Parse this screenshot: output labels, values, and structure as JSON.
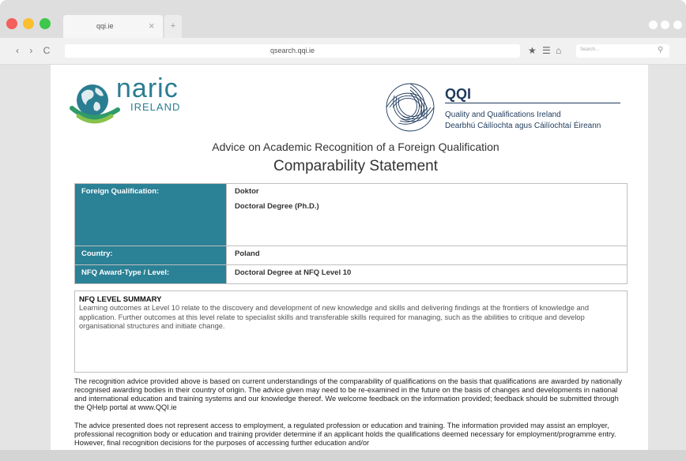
{
  "browser": {
    "tab_title": "qqi.ie",
    "tab_close": "×",
    "new_tab": "+",
    "url": "qsearch.qqi.ie",
    "nav": "‹ › C",
    "search_placeholder": "Search...",
    "icons": [
      "star-icon",
      "menu-icon",
      "home-icon",
      "search-icon"
    ]
  },
  "header": {
    "naric_logo_text": "naric",
    "naric_logo_sub": "IRELAND",
    "qqi_abbr": "QQI",
    "qqi_name_en": "Quality and Qualifications Ireland",
    "qqi_name_ga": "Dearbhú Cáilíochta agus Cáilíochtaí Éireann",
    "advice_title": "Advice on Academic Recognition of a Foreign Qualification",
    "statement_title": "Comparability Statement"
  },
  "qualification": {
    "foreign_label": "Foreign Qualification:",
    "foreign_value_1": "Doktor",
    "foreign_value_2": "Doctoral Degree (Ph.D.)",
    "country_label": "Country:",
    "country_value": "Poland",
    "nfq_label": "NFQ Award-Type /  Level:",
    "nfq_value": "Doctoral Degree at NFQ Level 10"
  },
  "summary": {
    "title": "NFQ LEVEL SUMMARY",
    "text": "Learning outcomes at Level 10 relate to the discovery and development of new knowledge and skills and delivering findings at the frontiers of knowledge and application. Further outcomes at this level relate to specialist skills and transferable skills required for managing, such as the abilities to critique and develop organisational structures and initiate change."
  },
  "disclaimer": {
    "para1": "The recognition advice provided above is based on current understandings of the comparability of qualifications on the basis that qualifications are awarded by nationally recognised awarding bodies in their country of origin. The advice given may need to be re-examined in the future on the basis of changes and developments in national and international education and training systems and our knowledge thereof. We welcome feedback on the information provided; feedback should be submitted through the QHelp portal at www.QQI.ie",
    "para2": "The advice presented does not represent access to employment, a regulated profession or education and training. The information provided may assist an employer, professional recognition body or education and training provider determine if an applicant holds the qualifications deemed necessary for employment/programme entry. However, final recognition decisions for the purposes of accessing further education and/or"
  },
  "colors": {
    "label_bg": "#2b8196",
    "naric_teal": "#2b7d92",
    "qqi_navy": "#1f3a5c"
  }
}
